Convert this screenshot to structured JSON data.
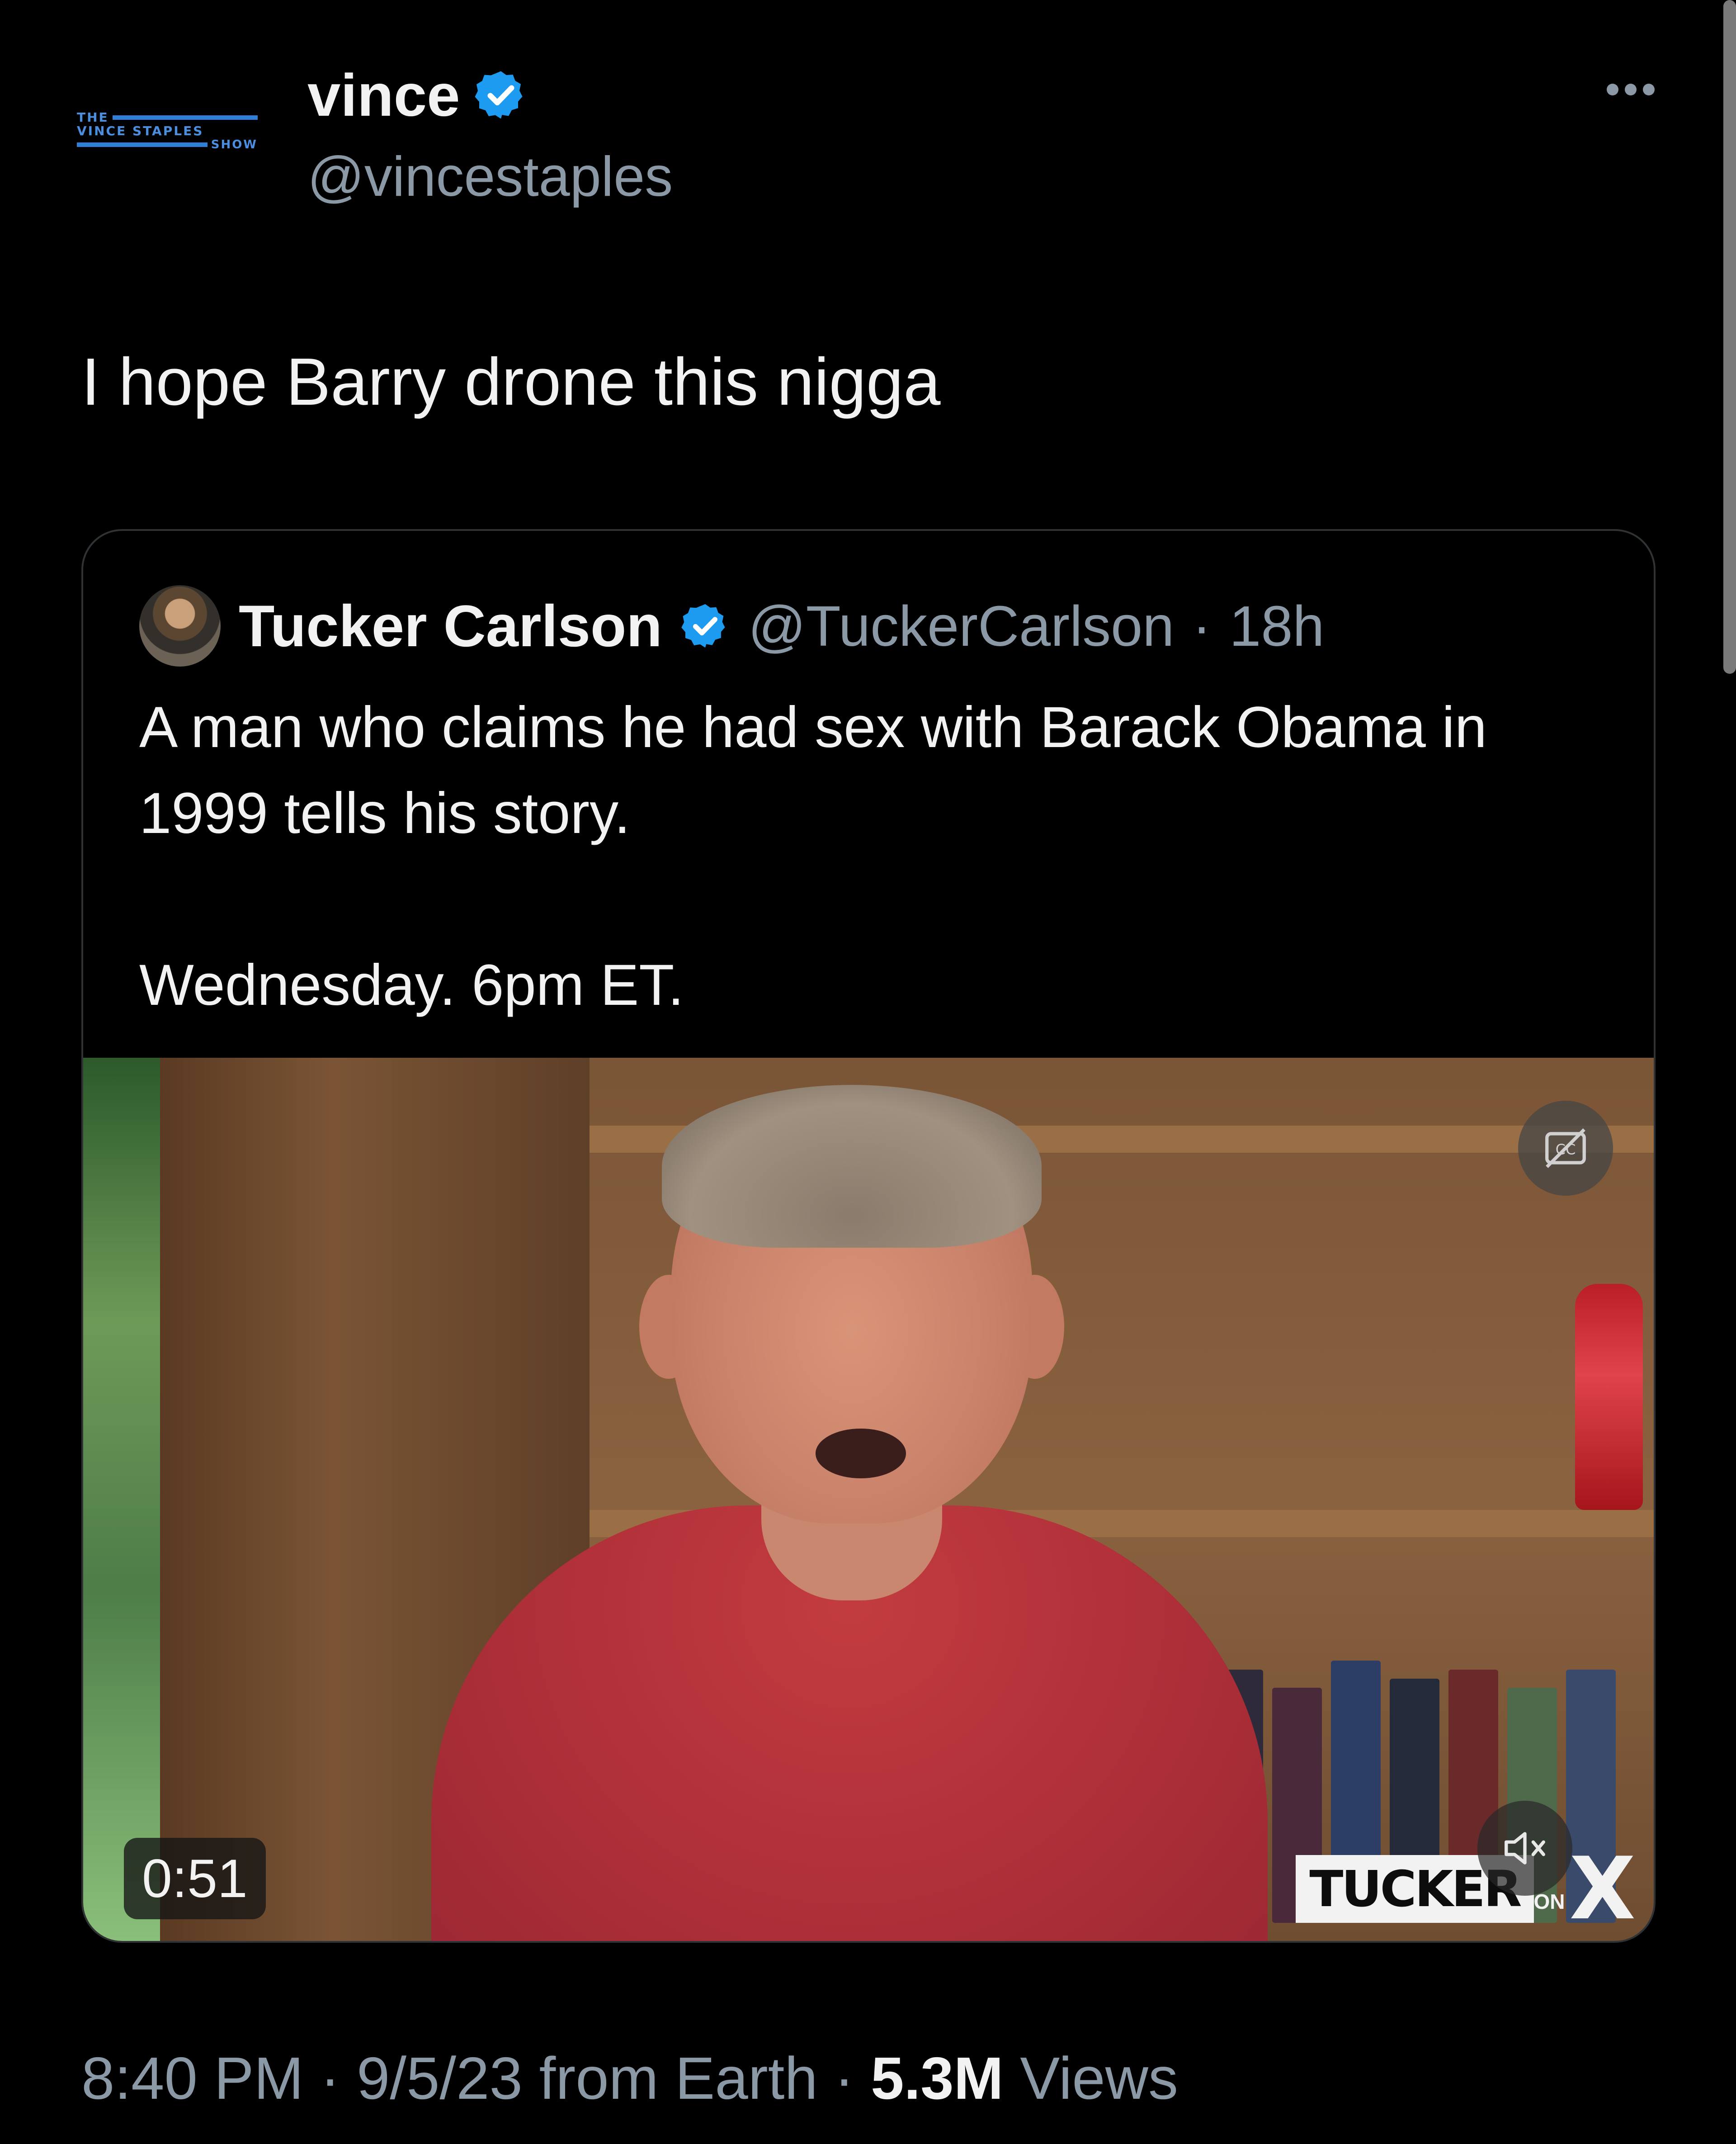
{
  "author": {
    "display_name": "vince",
    "handle": "@vincestaples",
    "avatar_logo_lines": [
      "THE",
      "VINCE STAPLES",
      "SHOW"
    ]
  },
  "tweet": {
    "text": "I hope Barry drone this nigga"
  },
  "quoted": {
    "display_name": "Tucker Carlson",
    "handle": "@TuckerCarlson",
    "separator": "·",
    "time": "18h",
    "text_line1": "A man who claims he had sex with Barack Obama in 1999 tells his story.",
    "text_line2": "Wednesday. 6pm ET.",
    "video": {
      "duration": "0:51",
      "watermark_word": "TUCKER",
      "watermark_small": "ON",
      "watermark_x": "X"
    }
  },
  "footer": {
    "time": "8:40 PM",
    "separator": "·",
    "date": "9/5/23",
    "source": "from Earth",
    "views_count": "5.3M",
    "views_label": "Views"
  },
  "colors": {
    "background": "#000000",
    "primary_text": "#f2f2f2",
    "secondary_text": "#8b98a5",
    "verified_blue": "#1d9bf0",
    "border": "#2f3336"
  }
}
